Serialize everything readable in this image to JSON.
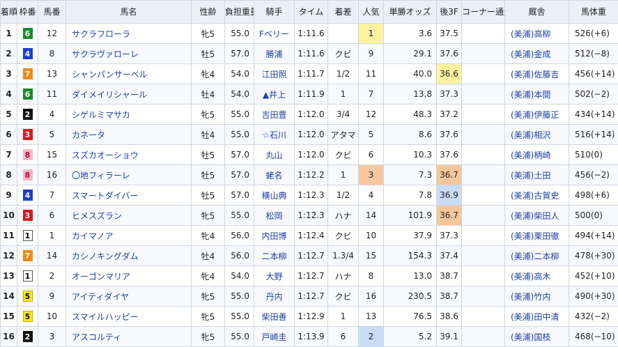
{
  "header": {
    "rank": "着順",
    "waku": "枠番",
    "umaban": "馬番",
    "horse": "馬名",
    "sexage": "性齢",
    "weight": "負担重量",
    "jockey": "騎手",
    "time": "タイム",
    "margin": "着差",
    "pop": "人気",
    "odds": "単勝オッズ",
    "last3f": "後3F",
    "corner": "コーナー通過順",
    "stable": "厩舎",
    "bodyweight": "馬体重"
  },
  "colors": {
    "waku1": "#ffffff",
    "waku2": "#111111",
    "waku3": "#e0161c",
    "waku4": "#1b3fd0",
    "waku5": "#ffee00",
    "waku6": "#1c8a2a",
    "waku7": "#f08a14",
    "waku8": "#f7b8c4",
    "pop1": "#fff3a0",
    "pop2": "#c9dcf7",
    "pop3": "#f9c79f",
    "f3_1": "#fff3a0",
    "f3_2": "#f6c79b",
    "f3_3": "#c9dcf7"
  },
  "rows": [
    {
      "rank": "1",
      "waku": "6",
      "umaban": "12",
      "horse": "サクラフローラ",
      "sexage": "牝5",
      "weight": "55.0",
      "jockey": "Fベリー",
      "time": "1:11.6",
      "margin": "",
      "pop": "1",
      "odds": "3.6",
      "last3f": "37.5",
      "corner": "",
      "stable": "(美浦)高柳",
      "bw": "526(+6)"
    },
    {
      "rank": "2",
      "waku": "4",
      "umaban": "8",
      "horse": "サクラヴァローレ",
      "sexage": "牡5",
      "weight": "57.0",
      "jockey": "勝浦",
      "time": "1:11.6",
      "margin": "クビ",
      "pop": "9",
      "odds": "29.1",
      "last3f": "37.6",
      "corner": "",
      "stable": "(美浦)金成",
      "bw": "512(−8)"
    },
    {
      "rank": "3",
      "waku": "7",
      "umaban": "13",
      "horse": "シャンパンサーベル",
      "sexage": "牝4",
      "weight": "54.0",
      "jockey": "江田照",
      "time": "1:11.7",
      "margin": "1/2",
      "pop": "11",
      "odds": "40.0",
      "last3f": "36.6",
      "corner": "",
      "stable": "(美浦)佐藤吉",
      "bw": "456(+14)"
    },
    {
      "rank": "4",
      "waku": "6",
      "umaban": "11",
      "horse": "ダイメイリシャール",
      "sexage": "牡4",
      "weight": "54.0",
      "jockey": "▲井上",
      "time": "1:11.9",
      "margin": "1",
      "pop": "7",
      "odds": "13.8",
      "last3f": "37.3",
      "corner": "",
      "stable": "(美浦)本間",
      "bw": "502(−2)"
    },
    {
      "rank": "5",
      "waku": "2",
      "umaban": "4",
      "horse": "シゲルミマサカ",
      "sexage": "牝5",
      "weight": "55.0",
      "jockey": "吉田豊",
      "time": "1:12.0",
      "margin": "3/4",
      "pop": "12",
      "odds": "48.3",
      "last3f": "37.2",
      "corner": "",
      "stable": "(美浦)伊藤正",
      "bw": "434(+14)"
    },
    {
      "rank": "6",
      "waku": "3",
      "umaban": "5",
      "horse": "カネータ",
      "sexage": "牡4",
      "weight": "55.0",
      "jockey": "☆石川",
      "time": "1:12.0",
      "margin": "アタマ",
      "pop": "5",
      "odds": "8.6",
      "last3f": "37.6",
      "corner": "",
      "stable": "(美浦)相沢",
      "bw": "516(+14)"
    },
    {
      "rank": "7",
      "waku": "8",
      "umaban": "15",
      "horse": "スズカオーショウ",
      "sexage": "牡5",
      "weight": "57.0",
      "jockey": "丸山",
      "time": "1:12.0",
      "margin": "クビ",
      "pop": "6",
      "odds": "10.3",
      "last3f": "37.6",
      "corner": "",
      "stable": "(美浦)柄崎",
      "bw": "510(0)"
    },
    {
      "rank": "8",
      "waku": "8",
      "umaban": "16",
      "horse": "〇地フィラーレ",
      "sexage": "牡5",
      "weight": "57.0",
      "jockey": "蛯名",
      "time": "1:12.2",
      "margin": "1",
      "pop": "3",
      "odds": "7.3",
      "last3f": "36.7",
      "corner": "",
      "stable": "(美浦)土田",
      "bw": "456(−2)"
    },
    {
      "rank": "9",
      "waku": "4",
      "umaban": "7",
      "horse": "スマートダイバー",
      "sexage": "牡5",
      "weight": "57.0",
      "jockey": "横山典",
      "time": "1:12.3",
      "margin": "1/2",
      "pop": "4",
      "odds": "7.8",
      "last3f": "36.9",
      "corner": "",
      "stable": "(美浦)古賀史",
      "bw": "498(+6)"
    },
    {
      "rank": "10",
      "waku": "3",
      "umaban": "6",
      "horse": "ヒメスズラン",
      "sexage": "牝5",
      "weight": "55.0",
      "jockey": "松岡",
      "time": "1:12.3",
      "margin": "ハナ",
      "pop": "14",
      "odds": "101.9",
      "last3f": "36.7",
      "corner": "",
      "stable": "(美浦)柴田人",
      "bw": "500(0)"
    },
    {
      "rank": "11",
      "waku": "1",
      "umaban": "1",
      "horse": "カイマノア",
      "sexage": "牝4",
      "weight": "56.0",
      "jockey": "内田博",
      "time": "1:12.4",
      "margin": "クビ",
      "pop": "10",
      "odds": "37.9",
      "last3f": "37.3",
      "corner": "",
      "stable": "(美浦)栗田徹",
      "bw": "494(+14)"
    },
    {
      "rank": "12",
      "waku": "7",
      "umaban": "14",
      "horse": "カシノキングダム",
      "sexage": "牡4",
      "weight": "56.0",
      "jockey": "二本柳",
      "time": "1:12.7",
      "margin": "1.3/4",
      "pop": "15",
      "odds": "154.3",
      "last3f": "37.4",
      "corner": "",
      "stable": "(美浦)二本柳",
      "bw": "478(+30)"
    },
    {
      "rank": "13",
      "waku": "1",
      "umaban": "2",
      "horse": "オーゴンマリア",
      "sexage": "牝4",
      "weight": "54.0",
      "jockey": "大野",
      "time": "1:12.7",
      "margin": "ハナ",
      "pop": "8",
      "odds": "13.0",
      "last3f": "38.7",
      "corner": "",
      "stable": "(美浦)高木",
      "bw": "452(+10)"
    },
    {
      "rank": "14",
      "waku": "5",
      "umaban": "9",
      "horse": "アイティダイヤ",
      "sexage": "牝5",
      "weight": "55.0",
      "jockey": "丹内",
      "time": "1:12.7",
      "margin": "クビ",
      "pop": "16",
      "odds": "230.5",
      "last3f": "38.7",
      "corner": "",
      "stable": "(美浦)竹内",
      "bw": "490(+30)"
    },
    {
      "rank": "15",
      "waku": "5",
      "umaban": "10",
      "horse": "スマイルハッピー",
      "sexage": "牝5",
      "weight": "55.0",
      "jockey": "柴田善",
      "time": "1:12.9",
      "margin": "1",
      "pop": "13",
      "odds": "76.5",
      "last3f": "38.6",
      "corner": "",
      "stable": "(美浦)田中清",
      "bw": "432(−2)"
    },
    {
      "rank": "16",
      "waku": "2",
      "umaban": "3",
      "horse": "アスコルティ",
      "sexage": "牝5",
      "weight": "55.0",
      "jockey": "戸崎圭",
      "time": "1:13.9",
      "margin": "6",
      "pop": "2",
      "odds": "5.2",
      "last3f": "39.1",
      "corner": "",
      "stable": "(美浦)国枝",
      "bw": "468(−10)"
    }
  ]
}
